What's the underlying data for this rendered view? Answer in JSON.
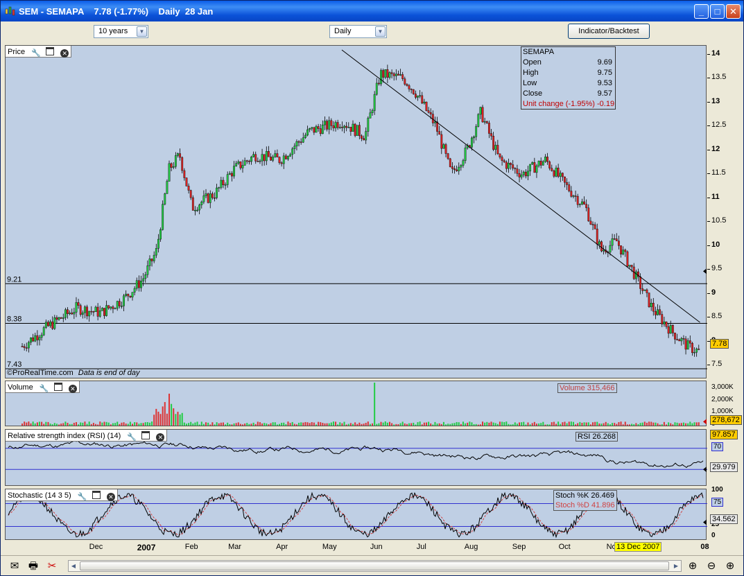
{
  "window": {
    "title": "SEM - SEMAPA    7.78 (-1.77%)    Daily  28 Jan",
    "buttons": {
      "minimize": "_",
      "maximize": "□",
      "close": "✕"
    }
  },
  "toolbar": {
    "period_value": "10 years",
    "interval_value": "Daily",
    "indicator_button_label": "Indicator/Backtest"
  },
  "panels": {
    "price": {
      "title": "Price"
    },
    "volume": {
      "title": "Volume",
      "readout": "Volume 315,466"
    },
    "rsi": {
      "title": "Relative strength index (RSI) (14)",
      "readout": "RSI 26.268"
    },
    "stochastic": {
      "title": "Stochastic (14 3 5)",
      "readout_k": "Stoch %K 26.469",
      "readout_d": "Stoch %D 41.896"
    }
  },
  "info_box": {
    "name": "SEMAPA",
    "rows": [
      {
        "label": "Open",
        "value": "9.69"
      },
      {
        "label": "High",
        "value": "9.75"
      },
      {
        "label": "Low",
        "value": "9.53"
      },
      {
        "label": "Close",
        "value": "9.57"
      }
    ],
    "unit_change": "Unit change (-1.95%) -0.19"
  },
  "footer": {
    "copyright": "©ProRealTime.com",
    "data_note": "Data is end of day"
  },
  "cursor_date": "13 Dec 2007",
  "chart_data": [
    {
      "type": "candlestick",
      "panel": "price",
      "ylim": [
        7.3,
        14.1
      ],
      "yticks": [
        "14",
        "13.5",
        "13",
        "12.5",
        "12",
        "11.5",
        "11",
        "10.5",
        "10",
        "9.5",
        "9",
        "8.5",
        "8",
        "7.5"
      ],
      "xticks": [
        "Dec",
        "2007",
        "Feb",
        "Mar",
        "Apr",
        "May",
        "Jun",
        "Jul",
        "Aug",
        "Sep",
        "Oct",
        "Nov",
        "08"
      ],
      "horizontal_lines": [
        {
          "label": "9.21",
          "value": 9.21
        },
        {
          "label": "8.38",
          "value": 8.38
        },
        {
          "label": "7.43",
          "value": 7.43
        }
      ],
      "trendline": [
        {
          "x": "2007-06-10",
          "y": 14.1
        },
        {
          "x": "2008-01-28",
          "y": 8.4
        }
      ],
      "last_value": "7.78",
      "series": [
        {
          "x": "2006-11-15",
          "close": 7.9
        },
        {
          "x": "2006-12-01",
          "close": 8.3
        },
        {
          "x": "2006-12-20",
          "close": 8.7
        },
        {
          "x": "2007-01-05",
          "close": 8.6
        },
        {
          "x": "2007-01-20",
          "close": 8.9
        },
        {
          "x": "2007-02-01",
          "close": 9.3
        },
        {
          "x": "2007-02-10",
          "close": 9.9
        },
        {
          "x": "2007-02-18",
          "close": 11.6
        },
        {
          "x": "2007-02-25",
          "close": 11.9
        },
        {
          "x": "2007-03-05",
          "close": 10.8
        },
        {
          "x": "2007-03-20",
          "close": 11.1
        },
        {
          "x": "2007-04-01",
          "close": 11.6
        },
        {
          "x": "2007-04-15",
          "close": 11.9
        },
        {
          "x": "2007-05-01",
          "close": 11.8
        },
        {
          "x": "2007-05-20",
          "close": 12.4
        },
        {
          "x": "2007-06-10",
          "close": 12.6
        },
        {
          "x": "2007-06-25",
          "close": 12.3
        },
        {
          "x": "2007-07-05",
          "close": 13.6
        },
        {
          "x": "2007-07-20",
          "close": 13.5
        },
        {
          "x": "2007-07-28",
          "close": 13.2
        },
        {
          "x": "2007-08-10",
          "close": 12.5
        },
        {
          "x": "2007-08-20",
          "close": 11.5
        },
        {
          "x": "2007-08-30",
          "close": 12.0
        },
        {
          "x": "2007-09-08",
          "close": 12.8
        },
        {
          "x": "2007-09-20",
          "close": 11.8
        },
        {
          "x": "2007-10-05",
          "close": 11.5
        },
        {
          "x": "2007-10-20",
          "close": 11.8
        },
        {
          "x": "2007-11-01",
          "close": 11.3
        },
        {
          "x": "2007-11-15",
          "close": 10.8
        },
        {
          "x": "2007-11-25",
          "close": 9.9
        },
        {
          "x": "2007-12-05",
          "close": 10.1
        },
        {
          "x": "2007-12-15",
          "close": 9.5
        },
        {
          "x": "2007-12-28",
          "close": 8.7
        },
        {
          "x": "2008-01-10",
          "close": 8.2
        },
        {
          "x": "2008-01-20",
          "close": 7.9
        },
        {
          "x": "2008-01-28",
          "close": 7.78
        }
      ]
    },
    {
      "type": "bar",
      "panel": "volume",
      "yticks": [
        "3,000K",
        "2,000K",
        "1,000K",
        "0"
      ],
      "last_value": "278,672",
      "spikes": [
        {
          "x": "2007-02-18",
          "value": 2600000
        },
        {
          "x": "2007-07-01",
          "value": 3500000
        }
      ]
    },
    {
      "type": "line",
      "panel": "rsi",
      "yticks": [
        "70",
        "30"
      ],
      "reference_lines": [
        70,
        30
      ],
      "values_shown": [
        "97.857",
        "29.979"
      ]
    },
    {
      "type": "line",
      "panel": "stochastic",
      "yticks": [
        "100",
        "75",
        "25",
        "0"
      ],
      "reference_lines": [
        75,
        25
      ],
      "values_shown": [
        "34.562"
      ]
    }
  ]
}
